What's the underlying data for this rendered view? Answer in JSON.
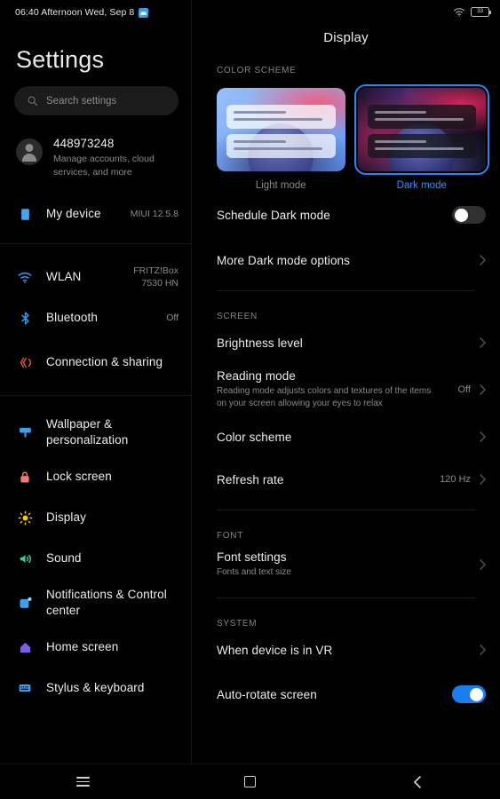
{
  "status_bar": {
    "time": "06:40 Afternoon  Wed, Sep 8",
    "weather_icon": "weather-badge-icon",
    "wifi_icon": "wifi-icon",
    "battery_level": "33"
  },
  "sidebar": {
    "title": "Settings",
    "search": {
      "icon": "search-icon",
      "placeholder": "Search settings"
    },
    "account": {
      "avatar_icon": "avatar-person-icon",
      "name": "448973248",
      "subtitle": "Manage accounts, cloud services, and more"
    },
    "device": {
      "icon": "device-icon",
      "label": "My device",
      "value": "MIUI 12.5.8"
    },
    "group_connectivity": [
      {
        "icon": "wifi-icon",
        "label": "WLAN",
        "value": "FRITZ!Box\n7530 HN"
      },
      {
        "icon": "bluetooth-icon",
        "label": "Bluetooth",
        "value": "Off"
      },
      {
        "icon": "connection-sharing-icon",
        "label": "Connection & sharing",
        "value": ""
      }
    ],
    "group_personalization": [
      {
        "icon": "wallpaper-icon",
        "label": "Wallpaper & personalization",
        "value": ""
      },
      {
        "icon": "lock-icon",
        "label": "Lock screen",
        "value": ""
      },
      {
        "icon": "display-sun-icon",
        "label": "Display",
        "value": ""
      },
      {
        "icon": "sound-speaker-icon",
        "label": "Sound",
        "value": ""
      },
      {
        "icon": "notifications-icon",
        "label": "Notifications & Control center",
        "value": ""
      },
      {
        "icon": "home-screen-icon",
        "label": "Home screen",
        "value": ""
      },
      {
        "icon": "stylus-keyboard-icon",
        "label": "Stylus & keyboard",
        "value": ""
      }
    ]
  },
  "main": {
    "title": "Display",
    "sections": {
      "color_scheme": {
        "label": "COLOR SCHEME",
        "cards": [
          {
            "label": "Light mode",
            "selected": false
          },
          {
            "label": "Dark mode",
            "selected": true
          }
        ],
        "rows": [
          {
            "title": "Schedule Dark mode",
            "control": "toggle",
            "toggle_on": false
          },
          {
            "title": "More Dark mode options",
            "control": "chevron"
          }
        ]
      },
      "screen": {
        "label": "SCREEN",
        "rows": [
          {
            "title": "Brightness level",
            "desc": "",
            "value": "",
            "control": "chevron"
          },
          {
            "title": "Reading mode",
            "desc": "Reading mode adjusts colors and textures of the items on your screen allowing your eyes to relax",
            "value": "Off",
            "control": "chevron"
          },
          {
            "title": "Color scheme",
            "desc": "",
            "value": "",
            "control": "chevron"
          },
          {
            "title": "Refresh rate",
            "desc": "",
            "value": "120 Hz",
            "control": "chevron"
          }
        ]
      },
      "font": {
        "label": "FONT",
        "rows": [
          {
            "title": "Font settings",
            "desc": "Fonts and text size",
            "value": "",
            "control": "chevron"
          }
        ]
      },
      "system": {
        "label": "SYSTEM",
        "rows": [
          {
            "title": "When device is in VR",
            "desc": "",
            "value": "",
            "control": "chevron"
          },
          {
            "title": "Auto-rotate screen",
            "desc": "",
            "value": "",
            "control": "toggle",
            "toggle_on": true
          }
        ]
      }
    }
  },
  "navbar": {
    "recents_icon": "menu-recents-icon",
    "home_icon": "home-square-icon",
    "back_icon": "back-chevron-icon"
  },
  "colors": {
    "accent_blue": "#2b83f6",
    "link_blue": "#3b8ef7",
    "toggle_on": "#1a7ef0"
  }
}
